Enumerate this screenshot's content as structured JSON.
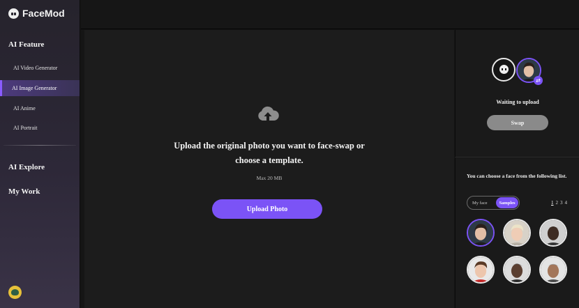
{
  "app": {
    "name": "FaceMod"
  },
  "sidebar": {
    "sections": [
      {
        "title": "AI Feature"
      },
      {
        "title": "AI Explore"
      },
      {
        "title": "My Work"
      }
    ],
    "items": [
      {
        "label": "AI Video Generator"
      },
      {
        "label": "AI Image Generator",
        "active": true
      },
      {
        "label": "AI Anime"
      },
      {
        "label": "AI Portrait"
      }
    ]
  },
  "main": {
    "message": "Upload the original photo you want to face-swap or choose a template.",
    "max_size": "Max 20 MB",
    "upload_label": "Upload Photo",
    "upload_icon": "cloud-upload-icon"
  },
  "swap_panel": {
    "status": "Waiting to upload",
    "swap_label": "Swap",
    "swap_icon": "swap-arrows-icon",
    "swap_glyph": "⇄"
  },
  "faces_panel": {
    "prompt": "You can choose a face from the following list.",
    "tabs": [
      "My face",
      "Samples"
    ],
    "active_tab": "Samples",
    "pages": [
      "1",
      "2",
      "3",
      "4"
    ],
    "current_page": "1",
    "selected_index": 0
  },
  "colors": {
    "accent": "#7b53f6",
    "sidebar_bg": "#2d2838",
    "main_bg": "#1c1c1c",
    "disabled_button": "#8a8a8a"
  }
}
